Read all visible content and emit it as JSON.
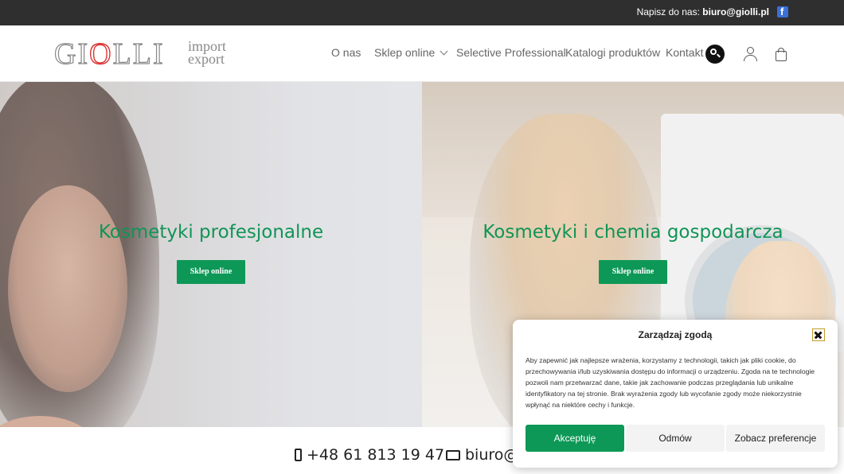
{
  "topbar": {
    "contact_prefix": "Napisz do nas:",
    "contact_email": "biuro@giolli.pl",
    "facebook_icon": "facebook-icon"
  },
  "header": {
    "logo_main": "GIOLLI",
    "logo_sub_1": "import",
    "logo_sub_2": "export",
    "nav": [
      {
        "label": "O nas"
      },
      {
        "label": "Sklep online"
      },
      {
        "label": "Selective Professional"
      },
      {
        "label": "Katalogi produktów"
      },
      {
        "label": "Kontakt"
      }
    ],
    "icons": [
      "search-icon",
      "user-icon",
      "bag-icon",
      "chevron-down-icon"
    ]
  },
  "hero": {
    "left": {
      "title": "Kosmetyki profesjonalne",
      "button": "Sklep online"
    },
    "right": {
      "title": "Kosmetyki i chemia gospodarcza",
      "button": "Sklep online"
    }
  },
  "footer": {
    "phone": "+48 61 813 19 47",
    "email": "biuro@g"
  },
  "cookie": {
    "title": "Zarządzaj zgodą",
    "text": "Aby zapewnić jak najlepsze wrażenia, korzystamy z technologii, takich jak pliki cookie, do przechowywania i/lub uzyskiwania dostępu do informacji o urządzeniu. Zgoda na te technologie pozwoli nam przetwarzać dane, takie jak zachowanie podczas przeglądania lub unikalne identyfikatory na tej stronie. Brak wyrażenia zgody lub wycofanie zgody może niekorzystnie wpłynąć na niektóre cechy i funkcje.",
    "accept": "Akceptuję",
    "deny": "Odmów",
    "prefs": "Zobacz preferencje"
  },
  "colors": {
    "brand_green": "#0d9857",
    "topbar_bg": "#2f2f2f"
  }
}
